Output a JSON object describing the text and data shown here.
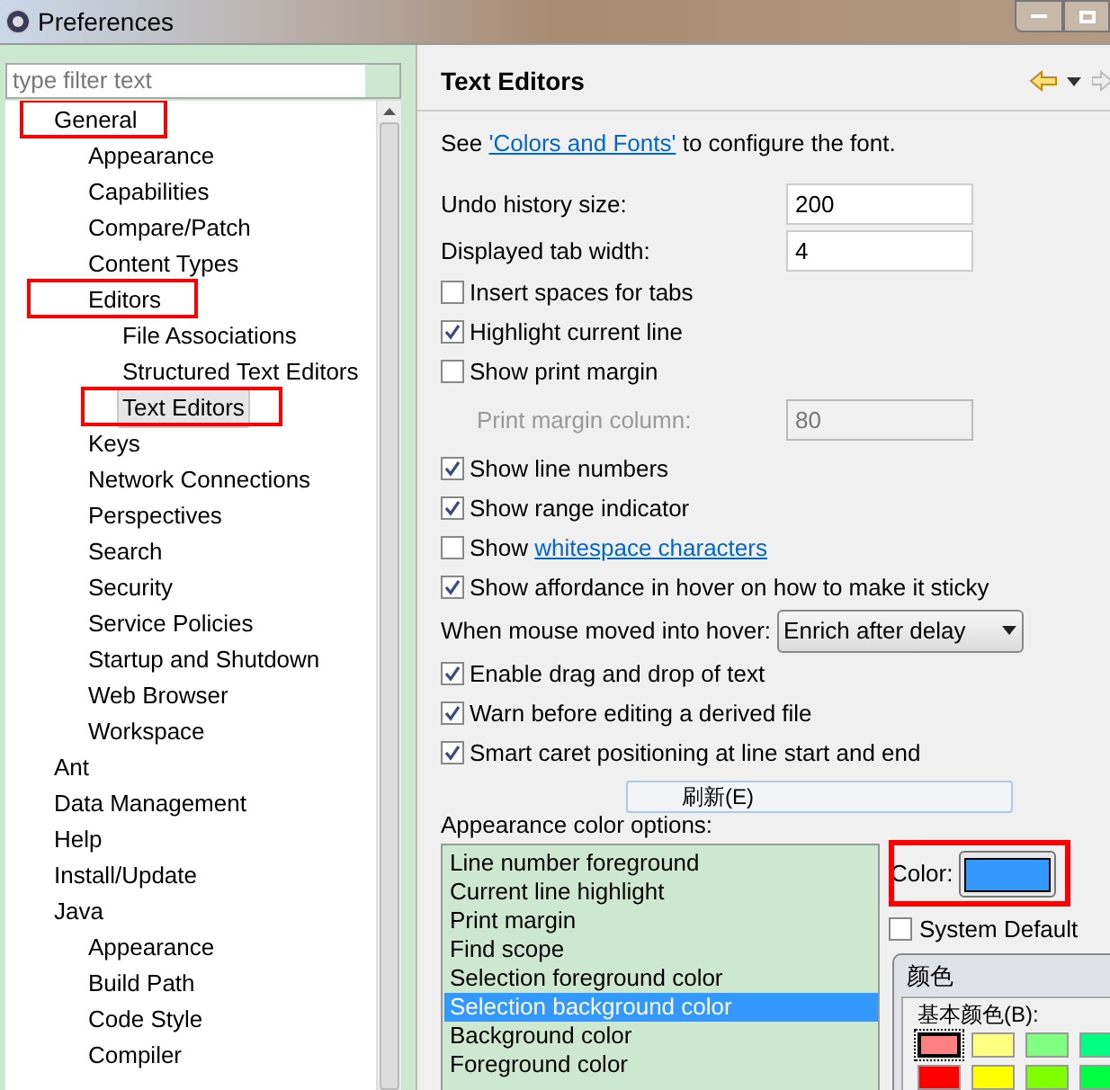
{
  "window": {
    "title": "Preferences"
  },
  "filter": {
    "placeholder": "type filter text"
  },
  "tree": [
    {
      "label": "General",
      "selected": false,
      "marked": true,
      "children": [
        {
          "label": "Appearance",
          "selected": false,
          "marked": false
        },
        {
          "label": "Capabilities",
          "selected": false,
          "marked": false
        },
        {
          "label": "Compare/Patch",
          "selected": false,
          "marked": false
        },
        {
          "label": "Content Types",
          "selected": false,
          "marked": false
        },
        {
          "label": "Editors",
          "selected": false,
          "marked": true,
          "children": [
            {
              "label": "File Associations",
              "selected": false,
              "marked": false
            },
            {
              "label": "Structured Text Editors",
              "selected": false,
              "marked": false
            },
            {
              "label": "Text Editors",
              "selected": true,
              "marked": true
            }
          ]
        },
        {
          "label": "Keys",
          "selected": false,
          "marked": false
        },
        {
          "label": "Network Connections",
          "selected": false,
          "marked": false
        },
        {
          "label": "Perspectives",
          "selected": false,
          "marked": false
        },
        {
          "label": "Search",
          "selected": false,
          "marked": false
        },
        {
          "label": "Security",
          "selected": false,
          "marked": false
        },
        {
          "label": "Service Policies",
          "selected": false,
          "marked": false
        },
        {
          "label": "Startup and Shutdown",
          "selected": false,
          "marked": false
        },
        {
          "label": "Web Browser",
          "selected": false,
          "marked": false
        },
        {
          "label": "Workspace",
          "selected": false,
          "marked": false
        }
      ]
    },
    {
      "label": "Ant",
      "selected": false,
      "marked": false
    },
    {
      "label": "Data Management",
      "selected": false,
      "marked": false
    },
    {
      "label": "Help",
      "selected": false,
      "marked": false
    },
    {
      "label": "Install/Update",
      "selected": false,
      "marked": false
    },
    {
      "label": "Java",
      "selected": false,
      "marked": false,
      "children": [
        {
          "label": "Appearance",
          "selected": false,
          "marked": false
        },
        {
          "label": "Build Path",
          "selected": false,
          "marked": false
        },
        {
          "label": "Code Style",
          "selected": false,
          "marked": false
        },
        {
          "label": "Compiler",
          "selected": false,
          "marked": false
        }
      ]
    }
  ],
  "page": {
    "title": "Text Editors",
    "intro": {
      "before": "See ",
      "link": "'Colors and Fonts'",
      "after": " to configure the font."
    },
    "settings": [
      {
        "kind": "field",
        "label": "Undo history size:",
        "value": "200",
        "disabled": false
      },
      {
        "kind": "field",
        "label": "Displayed tab width:",
        "value": "4",
        "disabled": false
      },
      {
        "kind": "check",
        "label": "Insert spaces for tabs",
        "checked": false
      },
      {
        "kind": "check",
        "label": "Highlight current line",
        "checked": true
      },
      {
        "kind": "check",
        "label": "Show print margin",
        "checked": false
      },
      {
        "kind": "field",
        "label": "Print margin column:",
        "value": "80",
        "disabled": true
      },
      {
        "kind": "check",
        "label": "Show line numbers",
        "checked": true
      },
      {
        "kind": "check",
        "label": "Show range indicator",
        "checked": true
      },
      {
        "kind": "checklink",
        "label": "Show ",
        "link": "whitespace characters",
        "checked": false
      },
      {
        "kind": "check",
        "label": "Show affordance in hover on how to make it sticky",
        "checked": true
      },
      {
        "kind": "select",
        "label": "When mouse moved into hover:",
        "value": "Enrich after delay"
      },
      {
        "kind": "check",
        "label": "Enable drag and drop of text",
        "checked": true
      },
      {
        "kind": "check",
        "label": "Warn before editing a derived file",
        "checked": true
      },
      {
        "kind": "check",
        "label": "Smart caret positioning at line start and end",
        "checked": true
      }
    ],
    "popup_menu": {
      "item": "刷新(E)"
    },
    "color_options": {
      "label": "Appearance color options:",
      "items": [
        {
          "label": "Line number foreground",
          "selected": false
        },
        {
          "label": "Current line highlight",
          "selected": false
        },
        {
          "label": "Print margin",
          "selected": false
        },
        {
          "label": "Find scope",
          "selected": false
        },
        {
          "label": "Selection foreground color",
          "selected": false
        },
        {
          "label": "Selection background color",
          "selected": true
        },
        {
          "label": "Background color",
          "selected": false
        },
        {
          "label": "Foreground color",
          "selected": false
        }
      ],
      "color_label": "Color:",
      "color": "#3399ff",
      "color_marked": true,
      "system_default": {
        "label": "System Default",
        "checked": false
      }
    }
  },
  "color_dialog": {
    "title": "颜色",
    "basic_label": "基本颜色(B):",
    "swatches": [
      {
        "color": "#ff8080",
        "selected": true
      },
      {
        "color": "#ffff80",
        "selected": false
      },
      {
        "color": "#80ff80",
        "selected": false
      },
      {
        "color": "#00ff80",
        "selected": false
      },
      {
        "color": "#ff0000",
        "selected": false
      },
      {
        "color": "#ffff00",
        "selected": false
      },
      {
        "color": "#80ff00",
        "selected": false
      },
      {
        "color": "#00ff40",
        "selected": false
      }
    ]
  }
}
